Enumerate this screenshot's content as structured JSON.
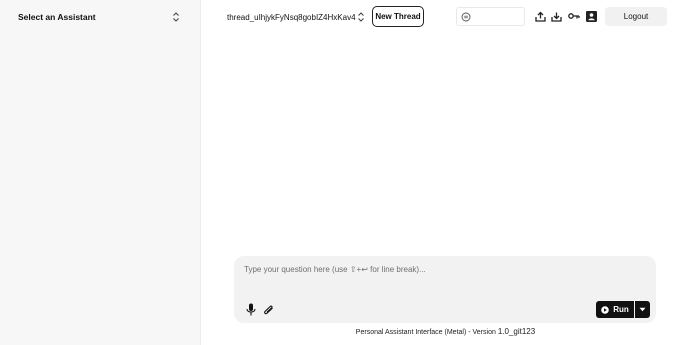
{
  "sidebar": {
    "assistant_select": {
      "label": "Select an Assistant",
      "icon": "chevron-up-down-icon"
    }
  },
  "topbar": {
    "thread_select": {
      "value": "thread_uIhjykFyNsq8gobIZ4HxKav4",
      "icon": "chevron-up-down-icon"
    },
    "new_thread_label": "New Thread",
    "search": {
      "icon": "search-icon",
      "placeholder": ""
    },
    "icons": [
      "upload-icon",
      "download-icon",
      "key-icon",
      "user-icon"
    ],
    "logout_label": "Logout"
  },
  "composer": {
    "placeholder": "Type your question here (use ⇧+↩ for line break)...",
    "mic_icon": "microphone-icon",
    "attach_icon": "paperclip-icon",
    "run_label": "Run",
    "run_icon": "play-icon",
    "run_menu_icon": "caret-down-icon"
  },
  "footer": {
    "text": "Personal Assistant Interface (Metal) - Version",
    "version": "1.0_git123"
  },
  "colors": {
    "sidebar_bg": "#f7f7f7",
    "composer_bg": "#f2f2f2",
    "button_dark": "#111111",
    "logout_bg": "#f1f1f1"
  }
}
